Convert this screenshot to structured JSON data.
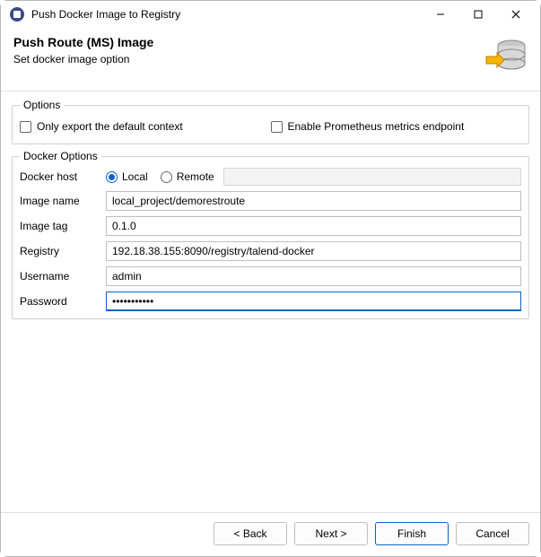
{
  "window": {
    "title": "Push Docker Image to Registry"
  },
  "banner": {
    "title": "Push Route (MS) Image",
    "subtitle": "Set docker image option"
  },
  "options_group": {
    "legend": "Options",
    "only_export_label": "Only export the default context",
    "only_export_checked": false,
    "prometheus_label": "Enable Prometheus metrics endpoint",
    "prometheus_checked": false
  },
  "docker_group": {
    "legend": "Docker Options",
    "docker_host_label": "Docker host",
    "radio_local": "Local",
    "radio_remote": "Remote",
    "radio_selected": "local",
    "image_name_label": "Image name",
    "image_name_value": "local_project/demorestroute",
    "image_tag_label": "Image tag",
    "image_tag_value": "0.1.0",
    "registry_label": "Registry",
    "registry_value": "192.18.38.155:8090/registry/talend-docker",
    "username_label": "Username",
    "username_value": "admin",
    "password_label": "Password",
    "password_value": "•••••••••••"
  },
  "buttons": {
    "back": "< Back",
    "next": "Next >",
    "finish": "Finish",
    "cancel": "Cancel"
  }
}
